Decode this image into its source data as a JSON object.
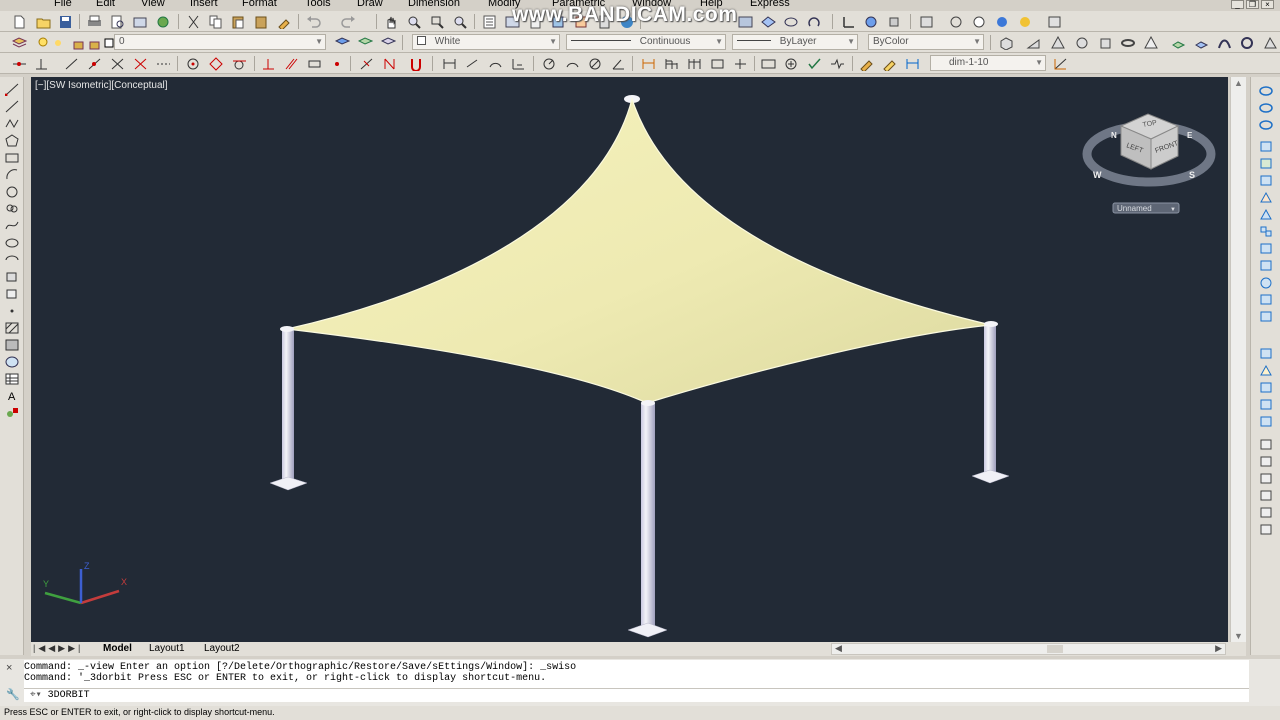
{
  "menu": [
    "File",
    "Edit",
    "View",
    "Insert",
    "Format",
    "Tools",
    "Draw",
    "Dimension",
    "Modify",
    "Parametric",
    "Window",
    "Help",
    "Express"
  ],
  "watermark": "www.BANDICAM.com",
  "layer_toolbar": {
    "current_layer": "0",
    "color_combo": "White",
    "linetype_combo": "Continuous",
    "lineweight_combo": "ByLayer",
    "plotstyle_combo": "ByColor"
  },
  "dim_style_combo": "dim-1-10",
  "viewport": {
    "label": "[−][SW Isometric][Conceptual]",
    "viewcube": {
      "faces": {
        "top": "TOP",
        "left": "LEFT",
        "front": "FRONT"
      },
      "compass": {
        "n": "N",
        "e": "E",
        "s": "S",
        "w": "W"
      },
      "ucs_menu": "Unnamed"
    },
    "ucs_axes": {
      "x": "X",
      "y": "Y",
      "z": "Z"
    },
    "colors": {
      "background": "#222a36",
      "canopy": "#f2efb8",
      "canopy_shade": "#ddd9a2",
      "columns": "#e9e8f2"
    }
  },
  "tabs": [
    "Model",
    "Layout1",
    "Layout2"
  ],
  "command": {
    "line1": "Command:  _-view Enter an option [?/Delete/Orthographic/Restore/Save/sEttings/Window]: _swiso",
    "line2": "Command: '_3dorbit Press ESC or ENTER to exit, or right-click to display shortcut-menu.",
    "input": "3DORBIT"
  },
  "status": "Press ESC or ENTER to exit, or right-click to display shortcut-menu."
}
